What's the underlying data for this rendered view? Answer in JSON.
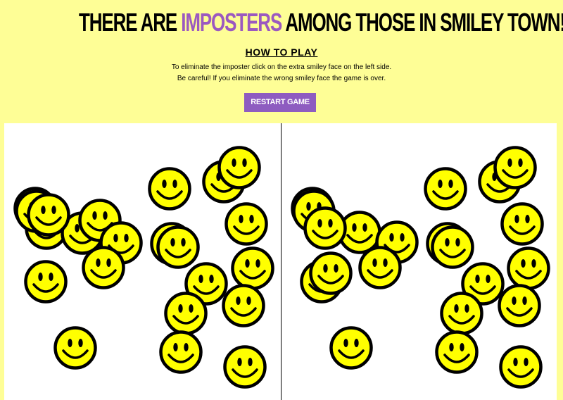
{
  "header": {
    "title_prefix": "THERE ARE ",
    "title_accent": "IMPOSTERS",
    "title_suffix": " AMONG THOSE IN SMILEY TOWN!",
    "accent_color": "#9b59c0"
  },
  "how_to_play": {
    "heading": "HOW TO PLAY",
    "line_1": "To eliminate the imposter click on the extra smiley face on the left side.",
    "line_2": "Be careful! If you eliminate the wrong smiley face the game is over."
  },
  "controls": {
    "restart_label": "RESTART GAME",
    "button_color": "#8e5cc0"
  },
  "boards": {
    "left_smiley_count": 22,
    "right_smiley_count": 21
  },
  "colors": {
    "background": "#fefe96",
    "smiley_fill": "#ffff00",
    "smiley_outline": "#000000"
  }
}
